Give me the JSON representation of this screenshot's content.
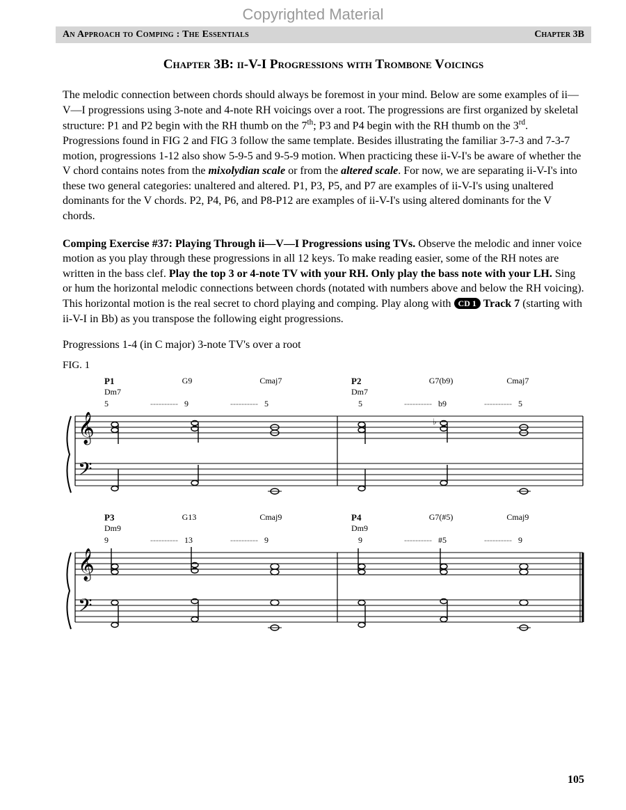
{
  "watermark": "Copyrighted Material",
  "header": {
    "left": "An Approach to Comping : The Essentials",
    "right": "Chapter 3B"
  },
  "chapter_title": "Chapter 3B: ii-V-I Progressions with Trombone Voicings",
  "para1": {
    "t1": "The melodic connection between chords should always be foremost in your mind. Below are some examples of ii—V—I progressions using 3-note and 4-note RH voicings over a root. The progressions are first organized by skeletal structure: P1 and P2 begin with the RH thumb on the 7",
    "sup1": "th",
    "t2": "; P3 and P4 begin with the RH thumb on the 3",
    "sup2": "rd",
    "t3": ". Progressions found in FIG 2 and FIG 3 follow the same template. Besides illustrating the familiar 3-7-3 and 7-3-7 motion, progressions 1-12 also show 5-9-5 and 9-5-9 motion. When practicing these ii-V-I's be aware of whether the V chord contains notes from the ",
    "bi1": "mixolydian scale",
    "t4": " or from the ",
    "bi2": "altered scale",
    "t5": ". For now, we are separating ii-V-I's into these two general categories: unaltered and altered. P1, P3, P5, and P7 are examples of ii-V-I's using unaltered dominants for the V chords. P2, P4, P6, and P8-P12 are examples of ii-V-I's using altered dominants for the V chords."
  },
  "para2": {
    "b1": "Comping Exercise #37: Playing Through ii—V—I Progressions using TVs.",
    "t1": " Observe the melodic and inner voice motion as you play through these progressions in all 12 keys. To make reading easier, some of the RH notes are written in the bass clef. ",
    "b2": "Play the top 3 or 4-note TV with your RH. Only play the bass note with your LH.",
    "t2": " Sing or hum the horizontal melodic connections between chords (notated with numbers above and below the RH voicing). This horizontal motion is the real secret to chord playing and comping. Play along with ",
    "cd": "CD 1",
    "b3": " Track 7",
    "t3": " (starting with ii-V-I in Bb) as you transpose the following eight progressions."
  },
  "prog_caption": "Progressions 1-4 (in C major) 3-note TV's over a root",
  "fig_label": "FIG. 1",
  "systems": [
    {
      "cols": [
        {
          "p": "P1",
          "chord": "Dm7",
          "top": "5"
        },
        {
          "p": "",
          "chord": "G9",
          "top": "9"
        },
        {
          "p": "",
          "chord": "Cmaj7",
          "top": "5"
        },
        {
          "p": "P2",
          "chord": "Dm7",
          "top": "5"
        },
        {
          "p": "",
          "chord": "G7(b9)",
          "top": "b9"
        },
        {
          "p": "",
          "chord": "Cmaj7",
          "top": "5"
        }
      ]
    },
    {
      "cols": [
        {
          "p": "P3",
          "chord": "Dm9",
          "top": "9"
        },
        {
          "p": "",
          "chord": "G13",
          "top": "13"
        },
        {
          "p": "",
          "chord": "Cmaj9",
          "top": "9"
        },
        {
          "p": "P4",
          "chord": "Dm9",
          "top": "9"
        },
        {
          "p": "",
          "chord": "G7(#5)",
          "top": "#5"
        },
        {
          "p": "",
          "chord": "Cmaj9",
          "top": "9"
        }
      ]
    }
  ],
  "page_number": "105"
}
